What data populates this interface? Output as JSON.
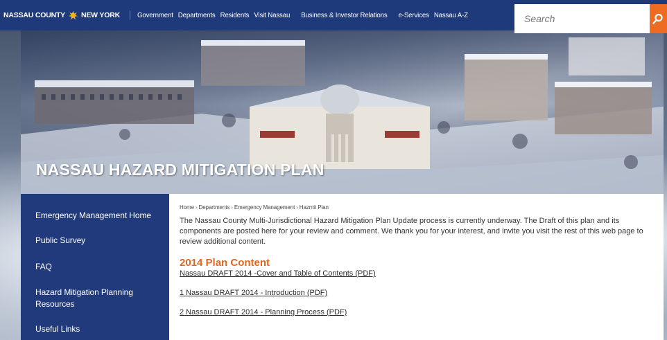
{
  "header": {
    "brand_left": "NASSAU COUNTY",
    "brand_right": "NEW YORK",
    "nav": [
      "Government",
      "Departments",
      "Residents",
      "Visit Nassau",
      "Business & Investor Relations",
      "e-Services",
      "Nassau A-Z"
    ],
    "search_placeholder": "Search"
  },
  "hero": {
    "title": "NASSAU HAZARD MITIGATION PLAN"
  },
  "sidebar": {
    "items": [
      {
        "label": "Emergency Management Home"
      },
      {
        "label": "Public Survey"
      },
      {
        "label": "FAQ"
      },
      {
        "label": "Hazard Mitigation Planning Resources"
      },
      {
        "label": "Useful Links"
      }
    ]
  },
  "breadcrumb": [
    "Home",
    "Departments",
    "Emergency Management",
    "Hazmit Plan"
  ],
  "content": {
    "intro": "The Nassau County Multi-Jurisdictional Hazard Mitigation Plan Update process is currently underway. The Draft of this plan and its components are posted here for your review and comment. We thank you for your interest, and invite you visit the rest of this web page to review additional content.",
    "section_title": "2014 Plan Content",
    "documents": [
      "Nassau DRAFT 2014 -Cover and Table of Contents (PDF)",
      "1 Nassau DRAFT 2014 - Introduction (PDF)",
      "2 Nassau DRAFT 2014 - Planning Process (PDF)"
    ]
  },
  "colors": {
    "nav_bg": "#1f3a7a",
    "sidebar_bg": "#213a7b",
    "accent_orange": "#ee6b22",
    "section_title": "#e2661f"
  },
  "icons": {
    "seal": "county-seal-icon",
    "search": "magnifier-icon"
  }
}
